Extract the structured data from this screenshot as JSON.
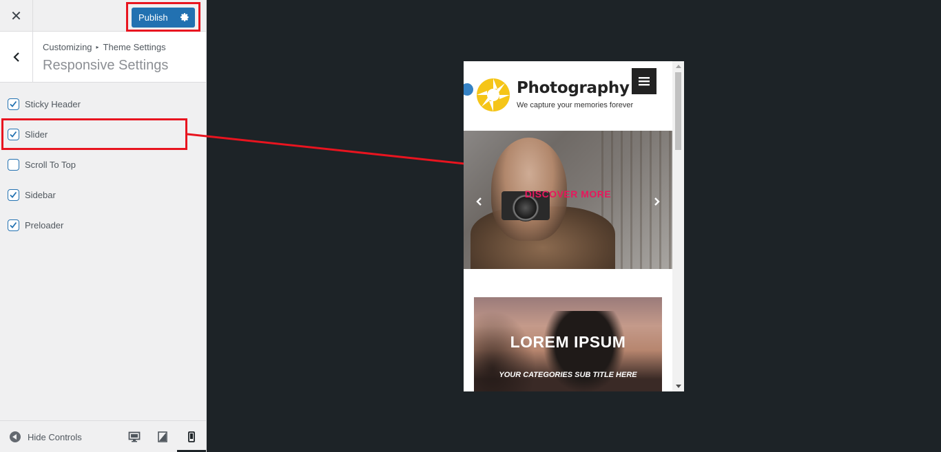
{
  "topbar": {
    "close_icon": "close-icon",
    "publish_label": "Publish",
    "publish_settings_icon": "gear-icon"
  },
  "header": {
    "breadcrumb_root": "Customizing",
    "breadcrumb_parent": "Theme Settings",
    "title": "Responsive Settings"
  },
  "controls": [
    {
      "label": "Sticky Header",
      "checked": true
    },
    {
      "label": "Slider",
      "checked": true
    },
    {
      "label": "Scroll To Top",
      "checked": false
    },
    {
      "label": "Sidebar",
      "checked": true
    },
    {
      "label": "Preloader",
      "checked": true
    }
  ],
  "footer": {
    "hide_controls_label": "Hide Controls",
    "devices": [
      "desktop",
      "tablet",
      "mobile"
    ],
    "active_device": "mobile"
  },
  "preview": {
    "site_title": "Photography",
    "site_tagline": "We capture your memories forever",
    "slider_cta": "DISCOVER MORE",
    "card_title": "LOREM IPSUM",
    "card_subtitle": "YOUR CATEGORIES SUB TITLE HERE"
  },
  "colors": {
    "accent": "#2271b1",
    "highlight": "#e8141f",
    "cta": "#e8175d",
    "logo_yellow": "#f5c518",
    "preview_bg": "#1d2327"
  }
}
